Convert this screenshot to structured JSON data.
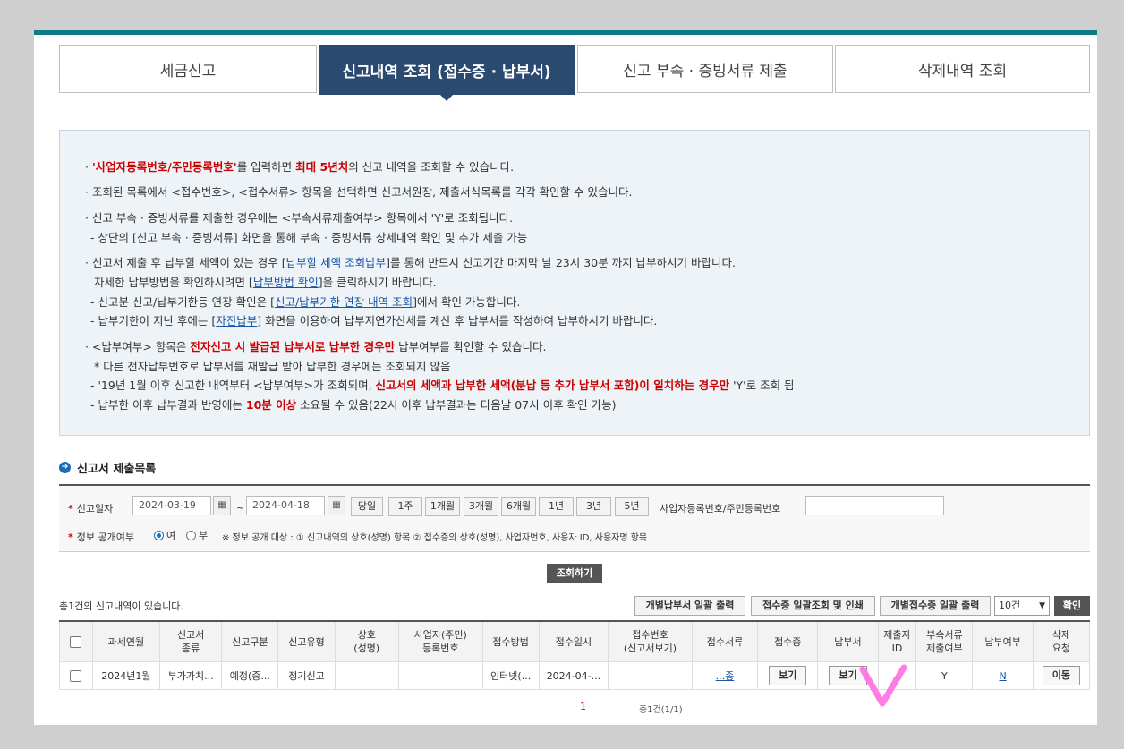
{
  "tabs": [
    {
      "label": "세금신고"
    },
    {
      "label": "신고내역 조회 (접수증 · 납부서)"
    },
    {
      "label": "신고 부속 · 증빙서류 제출"
    },
    {
      "label": "삭제내역 조회"
    }
  ],
  "info": {
    "l1_a": "'사업자등록번호/주민등록번호'",
    "l1_b": "를 입력하면 ",
    "l1_c": "최대 5년치",
    "l1_d": "의 신고 내역을 조회할 수 있습니다.",
    "l2": "조회된 목록에서 <접수번호>, <접수서류> 항목을 선택하면 신고서원장, 제출서식목록를 각각 확인할 수 있습니다.",
    "l3": "신고 부속 · 증빙서류를 제출한 경우에는 <부속서류제출여부> 항목에서 'Y'로 조회됩니다.",
    "l4": "- 상단의 [신고 부속 · 증빙서류] 화면을 통해 부속 · 증빙서류 상세내역 확인 및 추가 제출 가능",
    "l5_a": "신고서 제출 후 납부할 세액이 있는 경우 [",
    "l5_link": "납부할 세액 조회납부",
    "l5_b": "]를 통해 반드시 신고기간 마지막 날 23시 30분 까지 납부하시기 바랍니다.",
    "l6_a": "자세한 납부방법을 확인하시려면 [",
    "l6_link": "납부방법 확인",
    "l6_b": "]을 클릭하시기 바랍니다.",
    "l7_a": "- 신고분 신고/납부기한등 연장 확인은 [",
    "l7_link": "신고/납부기한 연장 내역 조회",
    "l7_b": "]에서 확인 가능합니다.",
    "l8_a": "- 납부기한이 지난 후에는 [",
    "l8_link": "자진납부",
    "l8_b": "] 화면을 이용하여 납부지연가산세를 계산 후 납부서를 작성하여 납부하시기 바랍니다.",
    "l9_a": "<납부여부> 항목은 ",
    "l9_red": "전자신고 시 발급된 납부서로 납부한 경우만",
    "l9_b": " 납부여부를 확인할 수 있습니다.",
    "l10": "* 다른 전자납부번호로 납부서를 재발급 받아 납부한 경우에는 조회되지 않음",
    "l11_a": "- '19년 1월 이후 신고한 내역부터 <납부여부>가 조회되며, ",
    "l11_red": "신고서의 세액과 납부한 세액(분납 등 추가 납부서 포함)이 일치하는 경우만",
    "l11_b": " 'Y'로 조회 됨",
    "l12_a": "- 납부한 이후 납부결과 반영에는 ",
    "l12_red": "10분 이상",
    "l12_b": " 소요될 수 있음(22시 이후 납부결과는 다음날 07시 이후 확인 가능)"
  },
  "section_title": "신고서 제출목록",
  "search": {
    "date_label": "신고일자",
    "date_from": "2024-03-19",
    "date_to": "2024-04-18",
    "tilde": "~",
    "periods": [
      "당일",
      "1주",
      "1개월",
      "3개월",
      "6개월",
      "1년",
      "3년",
      "5년"
    ],
    "bizno_label": "사업자등록번호/주민등록번호",
    "bizno_value": "",
    "disclose_label": "정보 공개여부",
    "yes": "여",
    "no": "부",
    "note": "※ 정보 공개 대상 : ① 신고내역의 상호(성명) 항목 ② 접수증의 상호(성명), 사업자번호, 사용자 ID, 사용자명 항목",
    "query_button": "조회하기"
  },
  "results": {
    "count_text": "총1건의 신고내역이 있습니다.",
    "btn_payment": "개별납부서 일괄 출력",
    "btn_receipt": "접수증 일괄조회 및 인쇄",
    "btn_receipt_each": "개별접수증 일괄 출력",
    "page_size": "10건",
    "ok": "확인"
  },
  "table": {
    "headers": [
      "과세연월",
      "신고서\n종류",
      "신고구분",
      "신고유형",
      "상호\n(성명)",
      "사업자(주민)\n등록번호",
      "접수방법",
      "접수일시",
      "접수번호\n(신고서보기)",
      "접수서류",
      "접수증",
      "납부서",
      "제출자\nID",
      "부속서류\n제출여부",
      "납부여부",
      "삭제\n요청"
    ],
    "row": {
      "period": "2024년1월",
      "type": "부가가치...",
      "category": "예정(중...",
      "kind": "정기신고",
      "name": "",
      "regno": "",
      "method": "인터넷(...",
      "datetime": "2024-04-...",
      "receipt_no": "",
      "docs": "...종",
      "receipt_btn": "보기",
      "payment_btn": "보기",
      "submitter": "...",
      "attach": "Y",
      "paid": "N",
      "delete_btn": "이동"
    }
  },
  "pager": {
    "current": "1",
    "info": "총1건(1/1)"
  },
  "colors": {
    "tab_active": "#2b4a70",
    "accent_red": "#c00000",
    "link": "#1a56a8",
    "marker": "#ff6ee0"
  }
}
